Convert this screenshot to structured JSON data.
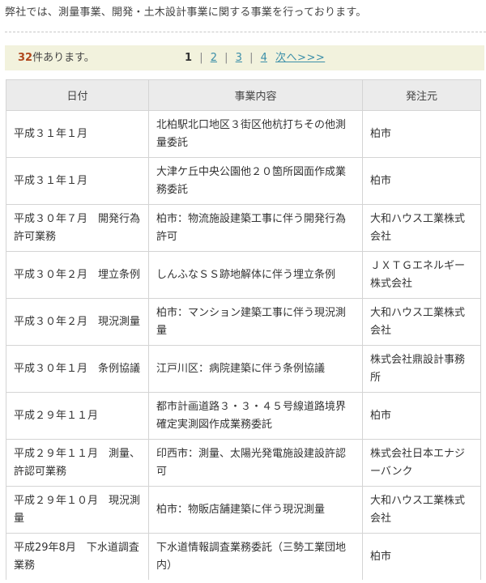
{
  "intro": "弊社では、測量事業、開発・土木設計事業に関する事業を行っております。",
  "result": {
    "count": "32",
    "count_suffix": "件あります。"
  },
  "pager": {
    "current": "1",
    "pages": [
      "2",
      "3",
      "4"
    ],
    "next": "次へ>>>",
    "separator": "|"
  },
  "table": {
    "headers": [
      "日付",
      "事業内容",
      "発注元"
    ],
    "rows": [
      {
        "date": "平成３１年１月",
        "content": "北柏駅北口地区３街区他杭打ちその他測量委託",
        "client": "柏市"
      },
      {
        "date": "平成３１年１月",
        "content": "大津ケ丘中央公園他２０箇所図面作成業務委託",
        "client": "柏市"
      },
      {
        "date": "平成３０年７月　開発行為許可業務",
        "content": "柏市：物流施設建築工事に伴う開発行為許可",
        "client": "大和ハウス工業株式会社"
      },
      {
        "date": "平成３０年２月　埋立条例",
        "content": "しんふなＳＳ跡地解体に伴う埋立条例",
        "client": "ＪＸＴＧエネルギー株式会社"
      },
      {
        "date": "平成３０年２月　現況測量",
        "content": "柏市：マンション建築工事に伴う現況測量",
        "client": "大和ハウス工業株式会社"
      },
      {
        "date": "平成３０年１月　条例協議",
        "content": "江戸川区：病院建築に伴う条例協議",
        "client": "株式会社鼎設計事務所"
      },
      {
        "date": "平成２９年１１月",
        "content": "都市計画道路３・３・４５号線道路境界確定実測図作成業務委託",
        "client": "柏市"
      },
      {
        "date": "平成２９年１１月　測量、許認可業務",
        "content": "印西市：測量、太陽光発電施設建設許認可",
        "client": "株式会社日本エナジーバンク"
      },
      {
        "date": "平成２９年１０月　現況測量",
        "content": "柏市：物販店舗建築に伴う現況測量",
        "client": "大和ハウス工業株式会社"
      },
      {
        "date": "平成29年8月　下水道調査業務",
        "content": "下水道情報調査業務委託（三勢工業団地内）",
        "client": "柏市"
      }
    ]
  }
}
